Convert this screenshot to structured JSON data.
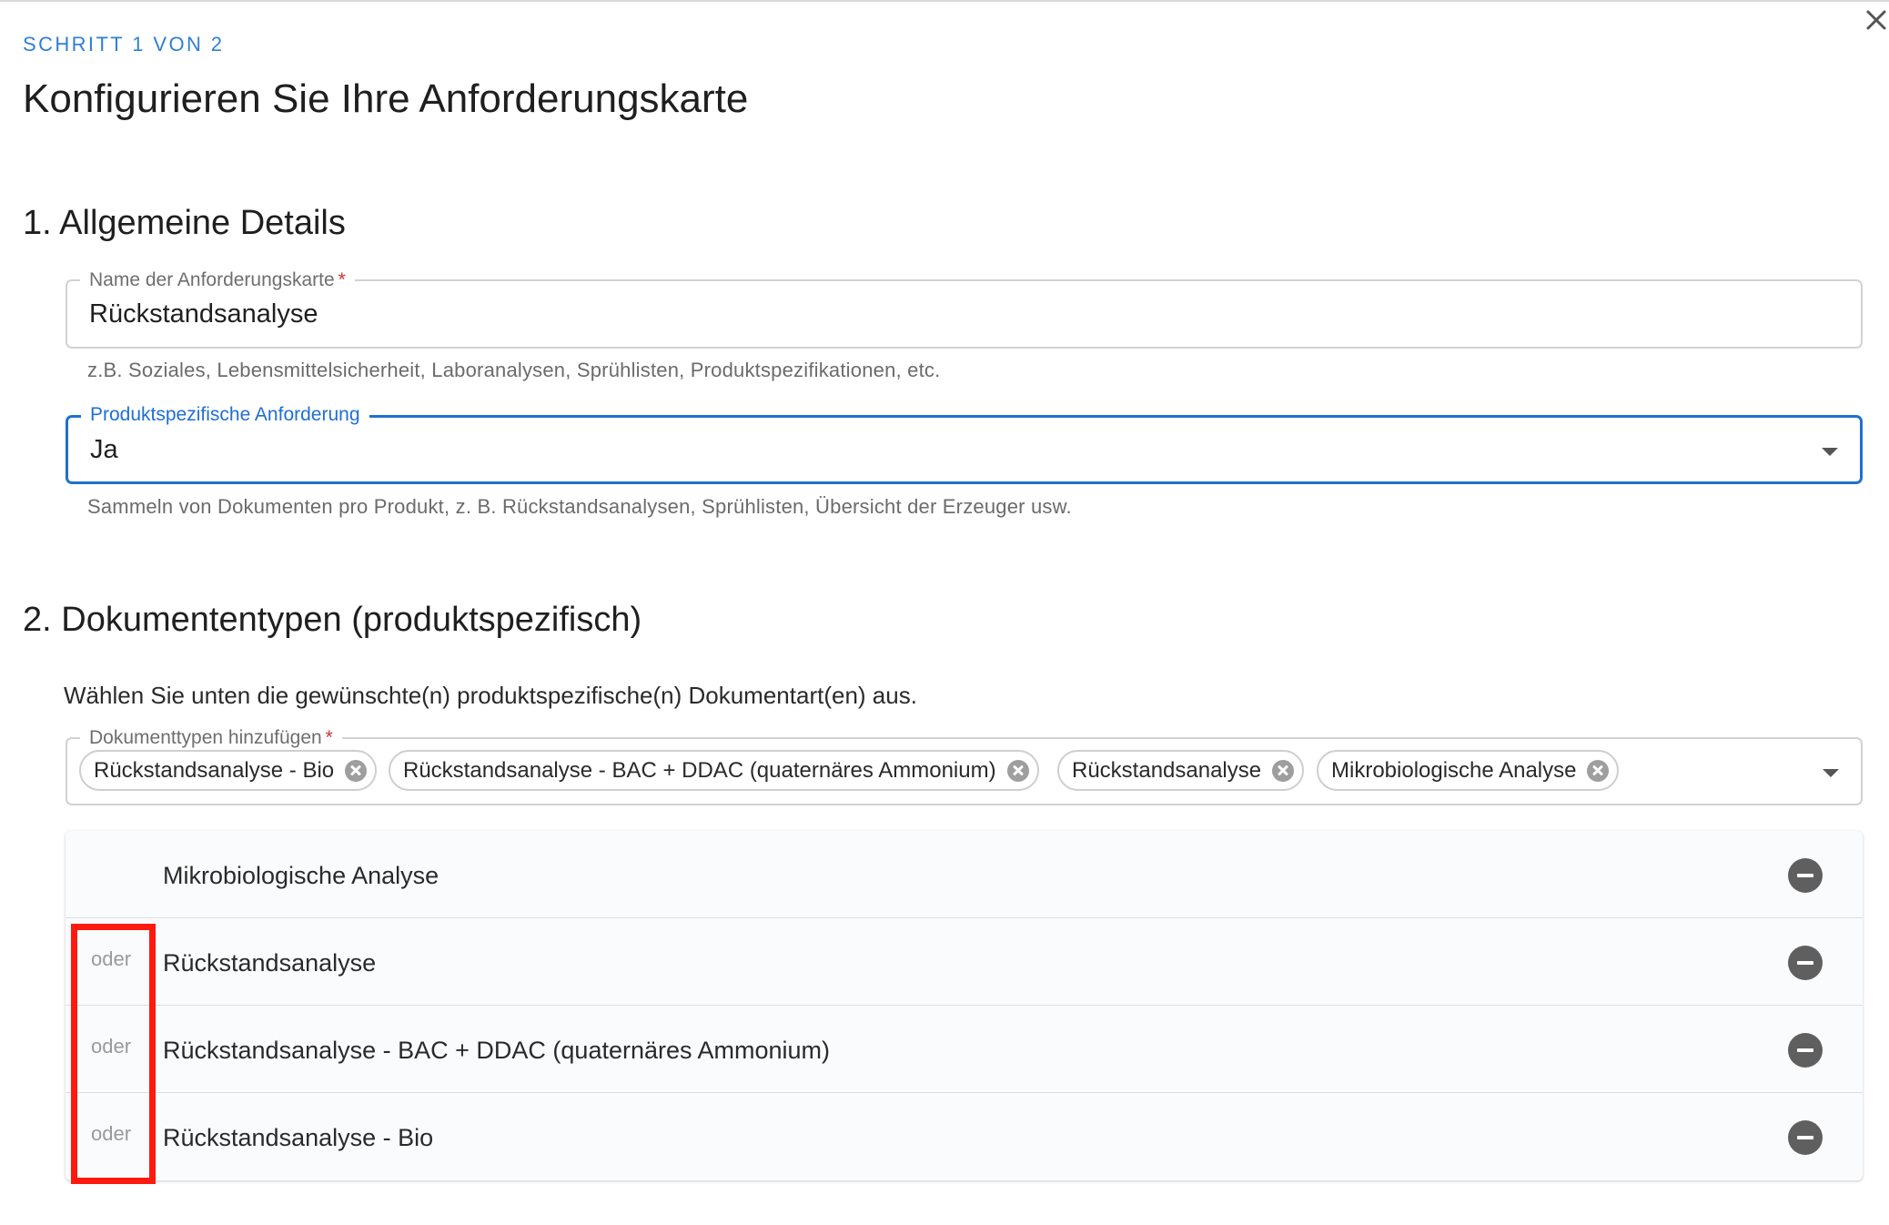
{
  "header": {
    "step": "SCHRITT 1 VON 2",
    "title": "Konfigurieren Sie Ihre Anforderungskarte",
    "close_icon": "close-icon"
  },
  "section1": {
    "title": "1. Allgemeine Details",
    "name_field": {
      "label": "Name der Anforderungskarte",
      "required_mark": "*",
      "value": "Rückstandsanalyse",
      "helper": "z.B. Soziales, Lebensmittelsicherheit, Laboranalysen, Sprühlisten, Produktspezifikationen, etc."
    },
    "product_field": {
      "label": "Produktspezifische Anforderung",
      "value": "Ja",
      "helper": "Sammeln von Dokumenten pro Produkt, z. B. Rückstandsanalysen, Sprühlisten, Übersicht der Erzeuger usw.",
      "icon": "chevron-down-icon",
      "accent_color": "#1f6fd1"
    }
  },
  "section2": {
    "title": "2. Dokumententypen (produktspezifisch)",
    "instruction": "Wählen Sie unten die gewünschte(n) produktspezifische(n) Dokumentart(en) aus.",
    "doc_field": {
      "label": "Dokumenttypen hinzufügen",
      "required_mark": "*",
      "chips": [
        "Rückstandsanalyse - Bio",
        "Rückstandsanalyse - BAC + DDAC (quaternäres Ammonium)",
        "Rückstandsanalyse",
        "Mikrobiologische Analyse"
      ],
      "chip_icon": "cancel-circle-icon"
    },
    "rows": [
      {
        "connector": "",
        "label": "Mikrobiologische Analyse"
      },
      {
        "connector": "oder",
        "label": "Rückstandsanalyse"
      },
      {
        "connector": "oder",
        "label": "Rückstandsanalyse - BAC + DDAC (quaternäres Ammonium)"
      },
      {
        "connector": "oder",
        "label": "Rückstandsanalyse - Bio"
      }
    ],
    "row_icon": "remove-circle-icon",
    "highlight_color": "#ff1a0f"
  }
}
